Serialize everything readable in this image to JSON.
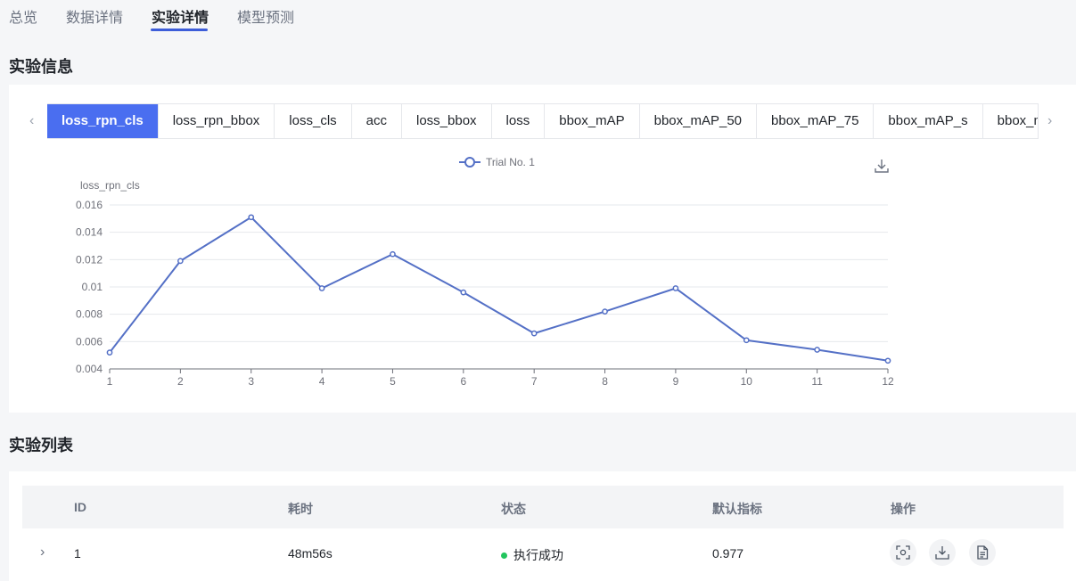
{
  "top_tabs": [
    {
      "label": "总览",
      "active": false
    },
    {
      "label": "数据详情",
      "active": false
    },
    {
      "label": "实验详情",
      "active": true
    },
    {
      "label": "模型预测",
      "active": false
    }
  ],
  "experiment_info": {
    "title": "实验信息"
  },
  "metric_tabs": [
    "loss_rpn_cls",
    "loss_rpn_bbox",
    "loss_cls",
    "acc",
    "loss_bbox",
    "loss",
    "bbox_mAP",
    "bbox_mAP_50",
    "bbox_mAP_75",
    "bbox_mAP_s",
    "bbox_mAP_m"
  ],
  "active_metric_index": 0,
  "chart_data": {
    "type": "line",
    "ylabel": "loss_rpn_cls",
    "x": [
      1,
      2,
      3,
      4,
      5,
      6,
      7,
      8,
      9,
      10,
      11,
      12
    ],
    "y_ticks": [
      "0.004",
      "0.006",
      "0.008",
      "0.01",
      "0.012",
      "0.014",
      "0.016"
    ],
    "ylim": [
      0.004,
      0.016
    ],
    "series": [
      {
        "name": "Trial No. 1",
        "values": [
          0.0052,
          0.0119,
          0.0151,
          0.0099,
          0.0124,
          0.0096,
          0.0066,
          0.0082,
          0.0099,
          0.0061,
          0.0054,
          0.0046
        ]
      }
    ],
    "grid": true,
    "legend": "top-center",
    "color": "#5470c6"
  },
  "experiment_list": {
    "title": "实验列表",
    "columns": [
      "ID",
      "耗时",
      "状态",
      "默认指标",
      "操作"
    ],
    "rows": [
      {
        "id": "1",
        "duration": "48m56s",
        "status": "执行成功",
        "metric": "0.977"
      }
    ]
  }
}
